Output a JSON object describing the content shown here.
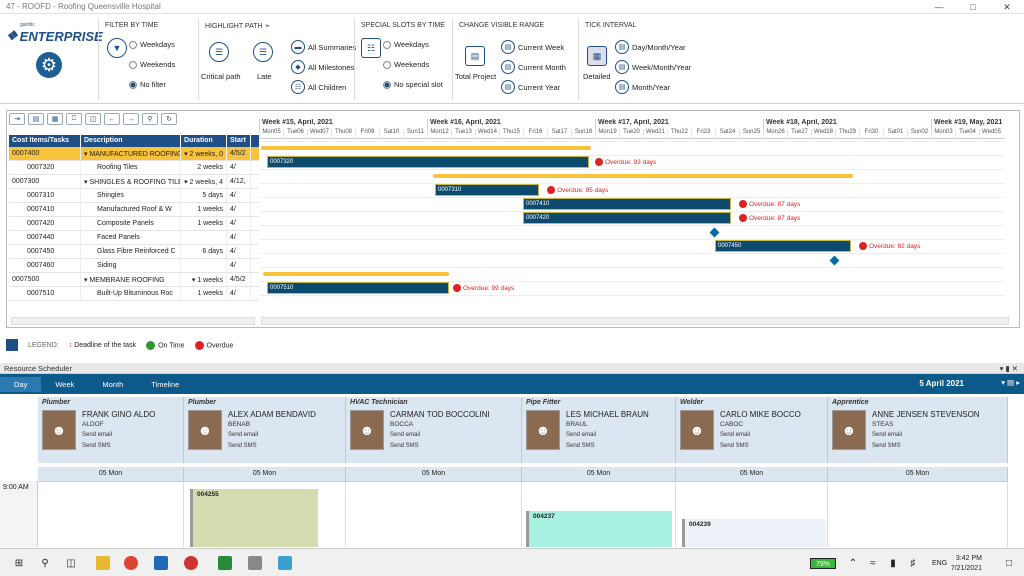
{
  "window": {
    "title": "47 - ROOFD - Roofing Queensville Hospital"
  },
  "logo": {
    "small": "ganttic",
    "big": "ENTERPRISE"
  },
  "ribbon": {
    "filter_by_time": {
      "title": "FILTER BY TIME",
      "options": [
        "Weekdays",
        "Weekends",
        "No filter"
      ]
    },
    "highlight_path": {
      "title": "HIGHLIGHT PATH",
      "items": [
        "Critical path",
        "Late",
        "All Summaries",
        "All Milestones",
        "All Children"
      ]
    },
    "special_slots": {
      "title": "SPECIAL SLOTS BY TIME",
      "options": [
        "Weekdays",
        "Weekends",
        "No special slot"
      ]
    },
    "visible_range": {
      "title": "CHANGE VISIBLE RANGE",
      "items": [
        "Total Project",
        "Current Week",
        "Current Month",
        "Current Year"
      ]
    },
    "tick_interval": {
      "title": "TICK INTERVAL",
      "items": [
        "Detailed",
        "Day/Month/Year",
        "Week/Month/Year",
        "Month/Year"
      ]
    }
  },
  "grid": {
    "headers": [
      "Cost Items/Tasks",
      "Description",
      "Duration",
      "Start"
    ],
    "rows": [
      {
        "id": "0007400",
        "desc": "MANUFACTURED ROOFING",
        "dur": "2 weeks, 0",
        "start": "4/5/2",
        "summary": true
      },
      {
        "id": "0007320",
        "desc": "Roofing Tiles",
        "dur": "2 weeks",
        "start": "4/"
      },
      {
        "id": "0007300",
        "desc": "SHINGLES & ROOFING TILE",
        "dur": "2 weeks, 4",
        "start": "4/12,",
        "summary": true
      },
      {
        "id": "0007310",
        "desc": "Shingles",
        "dur": "5 days",
        "start": "4/"
      },
      {
        "id": "0007410",
        "desc": "Manufactured Roof & W",
        "dur": "1 weeks",
        "start": "4/"
      },
      {
        "id": "0007420",
        "desc": "Composite Panels",
        "dur": "1 weeks",
        "start": "4/"
      },
      {
        "id": "0007440",
        "desc": "Faced Panels",
        "dur": "",
        "start": "4/"
      },
      {
        "id": "0007450",
        "desc": "Glass Fibre Reinforced C",
        "dur": "6 days",
        "start": "4/"
      },
      {
        "id": "0007460",
        "desc": "Siding",
        "dur": "",
        "start": "4/"
      },
      {
        "id": "0007500",
        "desc": "MEMBRANE ROOFING",
        "dur": "1 weeks",
        "start": "4/5/2",
        "summary": true
      },
      {
        "id": "0007510",
        "desc": "Built-Up Bituminous Roc",
        "dur": "1 weeks",
        "start": "4/"
      }
    ]
  },
  "chart": {
    "weeks": [
      "Week #15, April, 2021",
      "Week #16, April, 2021",
      "Week #17, April, 2021",
      "Week #18, April, 2021",
      "Week #19, May, 2021"
    ],
    "days": [
      "Mon05",
      "Tue06",
      "Wed07",
      "Thu08",
      "Fri09",
      "Sat10",
      "Sun11",
      "Mon12",
      "Tue13",
      "Wed14",
      "Thu15",
      "Fri16",
      "Sat17",
      "Sun18",
      "Mon19",
      "Tue20",
      "Wed21",
      "Thu22",
      "Fri23",
      "Sat24",
      "Sun25",
      "Mon26",
      "Tue27",
      "Wed28",
      "Thu29",
      "Fri30",
      "Sat01",
      "Sun02",
      "Mon03",
      "Tue04",
      "Wed05"
    ],
    "bars": [
      {
        "label": "0007320",
        "overdue": "Overdue: 93 days"
      },
      {
        "label": "0007310",
        "overdue": "Overdue: 95 days"
      },
      {
        "label": "0007410",
        "overdue": "Overdue: 87 days"
      },
      {
        "label": "0007420",
        "overdue": "Overdue: 87 days"
      },
      {
        "label": "0007450",
        "overdue": "Overdue: 82 days"
      },
      {
        "label": "0007510",
        "overdue": "Overdue: 99 days"
      }
    ]
  },
  "legend": {
    "title": "LEGEND:",
    "deadline": "Deadline of the task",
    "ontime": "On Time",
    "overdue": "Overdue"
  },
  "scheduler": {
    "title": "Resource Scheduler",
    "views": [
      "Day",
      "Week",
      "Month",
      "Timeline"
    ],
    "date": "5 April 2021",
    "day_label": "05 Mon",
    "time": "9:00 AM",
    "send_email": "Send email",
    "send_sms": "Send SMS",
    "resources": [
      {
        "role": "Plumber",
        "name": "FRANK GINO ALDO",
        "code": "ALDOF"
      },
      {
        "role": "Plumber",
        "name": "ALEX ADAM BENDAVID",
        "code": "BENAB"
      },
      {
        "role": "HVAC Technician",
        "name": "CARMAN TOD BOCCOLINI",
        "code": "BOCCA"
      },
      {
        "role": "Pipe Fitter",
        "name": "LES MICHAEL BRAUN",
        "code": "BRAUL"
      },
      {
        "role": "Welder",
        "name": "CARLO MIKE BOCCO",
        "code": "CABOC"
      },
      {
        "role": "Apprentice",
        "name": "ANNE JENSEN STEVENSON",
        "code": "STEAS"
      }
    ],
    "appointments": [
      "004255",
      "004237",
      "004239"
    ]
  },
  "taskbar": {
    "battery": "79%",
    "lang": "ENG",
    "time": "3:42 PM",
    "date": "7/21/2021"
  }
}
